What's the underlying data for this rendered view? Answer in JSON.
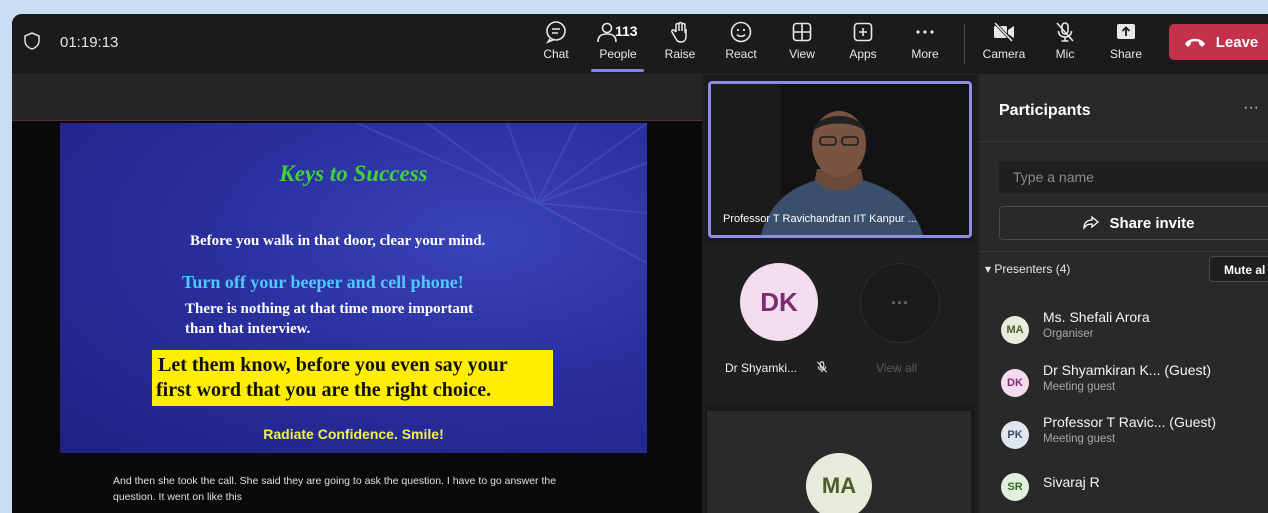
{
  "meeting": {
    "timer": "01:19:13"
  },
  "toolbar": {
    "chat": "Chat",
    "people": "People",
    "people_count": "113",
    "raise": "Raise",
    "react": "React",
    "view": "View",
    "apps": "Apps",
    "more": "More",
    "camera": "Camera",
    "mic": "Mic",
    "share": "Share",
    "leave": "Leave"
  },
  "slide": {
    "title": "Keys to Success",
    "line1": "Before you walk in that door, clear your mind.",
    "line2": "Turn off your beeper and cell phone!",
    "line3a": "There is nothing at that time more important",
    "line3b": "than that interview.",
    "highlight1": "Let them know, before you even say your",
    "highlight2": "first word that you are the right choice.",
    "footer": "Radiate Confidence.  Smile!"
  },
  "caption": "And then she took the call. She said they are going to ask the question. I have to go answer the question. It went on like this",
  "videos": {
    "main_name": "Professor T Ravichandran IIT Kanpur ...",
    "dk_initials": "DK",
    "dk_name": "Dr Shyamki...",
    "more_glyph": "···",
    "view_all": "View all",
    "ma_initials": "MA"
  },
  "panel": {
    "title": "Participants",
    "menu": "···",
    "search_placeholder": "Type a name",
    "share_invite": "Share invite",
    "presenters_label": "Presenters (4)",
    "mute_all": "Mute al",
    "people": [
      {
        "initials": "MA",
        "name": "Ms. Shefali Arora",
        "role": "Organiser"
      },
      {
        "initials": "DK",
        "name": "Dr Shyamkiran K... (Guest)",
        "role": "Meeting guest"
      },
      {
        "initials": "PK",
        "name": "Professor T Ravic... (Guest)",
        "role": "Meeting guest"
      },
      {
        "initials": "SR",
        "name": "Sivaraj R",
        "role": ""
      }
    ]
  },
  "colors": {
    "leave": "#c4314b",
    "accent": "#7f85f5",
    "slide_blue": "#2a2f9e",
    "slide_title_green": "#3fd23f",
    "highlight_yellow": "#ffee00"
  }
}
